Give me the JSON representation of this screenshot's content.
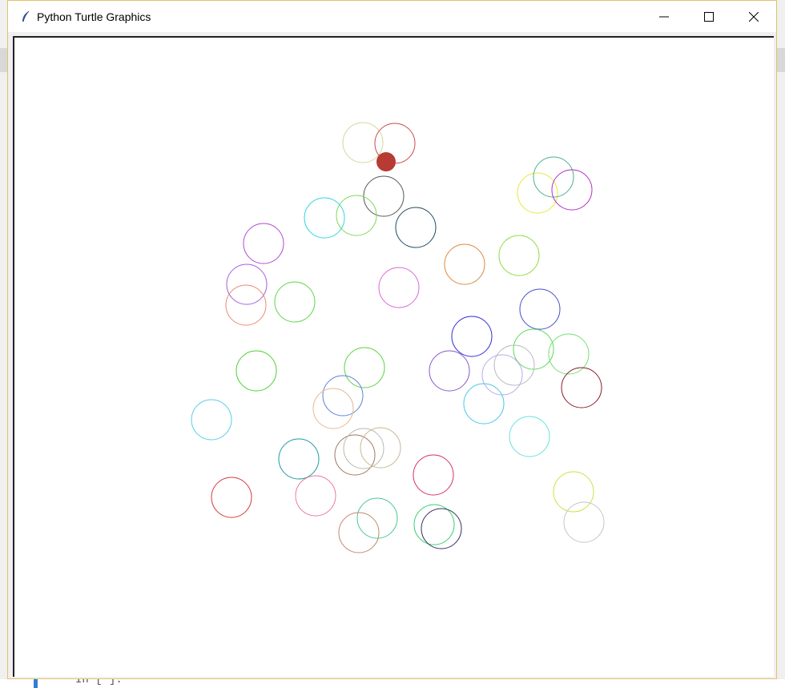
{
  "window": {
    "title": "Python Turtle Graphics",
    "border_color": "#e3c36a"
  },
  "controls": {
    "minimize_icon": "minimize-icon",
    "maximize_icon": "maximize-icon",
    "close_icon": "close-icon"
  },
  "background_app": {
    "visible_text": "In [ ]:",
    "marker_color": "#2f7fd6"
  },
  "turtle": {
    "fill_color": "#b73a33"
  },
  "circles": [
    {
      "color": "#cfd99a"
    },
    {
      "color": "#c94a4a"
    },
    {
      "color": "#555555"
    },
    {
      "color": "#2fd6e0"
    },
    {
      "color": "#7ed85a"
    },
    {
      "color": "#1d4a63"
    },
    {
      "color": "#b04ad0"
    },
    {
      "color": "#d98840"
    },
    {
      "color": "#8ddb3f"
    },
    {
      "color": "#e8e83a"
    },
    {
      "color": "#4fb08c"
    },
    {
      "color": "#b030c0"
    },
    {
      "color": "#a55de0"
    },
    {
      "color": "#ee8a70"
    },
    {
      "color": "#5cd648"
    },
    {
      "color": "#d868d8"
    },
    {
      "color": "#4550c8"
    },
    {
      "color": "#2d2dd6"
    },
    {
      "color": "#58d95a"
    },
    {
      "color": "#72e076"
    },
    {
      "color": "#4ad030"
    },
    {
      "color": "#5ad33a"
    },
    {
      "color": "#8a58c8"
    },
    {
      "color": "#b9a8e8"
    },
    {
      "color": "#b8b8c0"
    },
    {
      "color": "#8b1a2a"
    },
    {
      "color": "#5a82d8"
    },
    {
      "color": "#e8b890"
    },
    {
      "color": "#45c8e8"
    },
    {
      "color": "#58cde8"
    },
    {
      "color": "#68e0e0"
    },
    {
      "color": "#1d9aa8"
    },
    {
      "color": "#a0785a"
    },
    {
      "color": "#b8b8b0"
    },
    {
      "color": "#c8b890"
    },
    {
      "color": "#d83060"
    },
    {
      "color": "#d83838"
    },
    {
      "color": "#e87898"
    },
    {
      "color": "#d0e040"
    },
    {
      "color": "#c0c8c8"
    },
    {
      "color": "#48c890"
    },
    {
      "color": "#c08870"
    },
    {
      "color": "#38d070"
    },
    {
      "color": "#303060"
    }
  ]
}
